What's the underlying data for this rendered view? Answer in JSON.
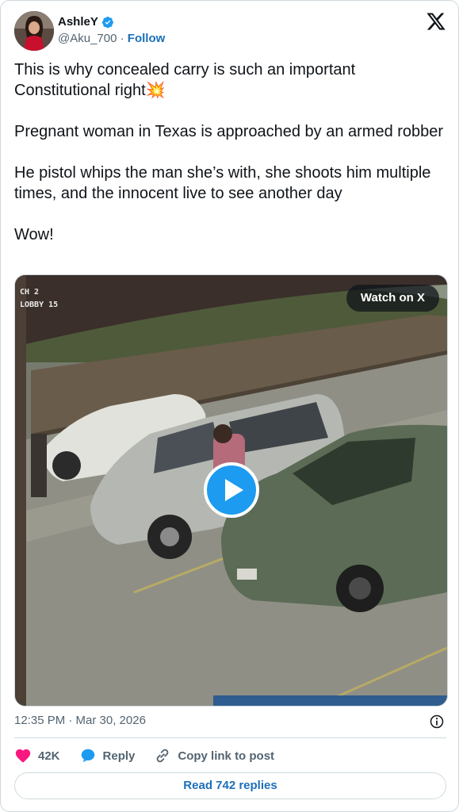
{
  "author": {
    "name": "AshleY",
    "handle": "@Aku_700",
    "separator": " · ",
    "follow_label": "Follow",
    "verified": true
  },
  "post": {
    "paragraphs": [
      "This is why concealed carry is such an important Constitutional right💥",
      "Pregnant woman in Texas is approached by an armed robber",
      "He pistol whips the man she’s with, she shoots him multiple times, and the innocent live to see another day",
      "Wow!"
    ]
  },
  "media": {
    "watch_label": "Watch on X",
    "overlay_line1": "CH 2",
    "overlay_line2": "LOBBY 15"
  },
  "meta": {
    "timestamp": "12:35 PM · Mar 30, 2026"
  },
  "actions": {
    "likes": "42K",
    "reply_label": "Reply",
    "copy_label": "Copy link to post"
  },
  "read_replies_label": "Read 742 replies",
  "colors": {
    "accent": "#1d9bf0",
    "link": "#1d6fb8",
    "like": "#f91880",
    "muted": "#536471"
  },
  "icons": [
    "verified-badge-icon",
    "x-logo-icon",
    "play-icon",
    "info-icon",
    "heart-icon",
    "reply-bubble-icon",
    "link-icon"
  ]
}
